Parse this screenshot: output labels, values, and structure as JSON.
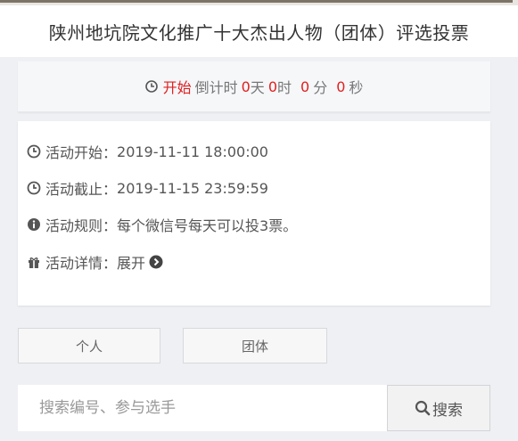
{
  "header": {
    "title": "陕州地坑院文化推广十大杰出人物（团体）评选投票"
  },
  "countdown": {
    "status": "开始",
    "prefix": "倒计时",
    "days": "0",
    "days_unit": "天",
    "hours": "0",
    "hours_unit": "时",
    "minutes": "0",
    "minutes_unit": "分",
    "seconds": "0",
    "seconds_unit": "秒",
    "icon": "clock-icon",
    "accent_color": "#e02020"
  },
  "info": {
    "start_label": "活动开始：",
    "start_value": "2019-11-11 18:00:00",
    "end_label": "活动截止：",
    "end_value": "2019-11-15 23:59:59",
    "rules_label": "活动规则：",
    "rules_value": "每个微信号每天可以投3票。",
    "details_label": "活动详情：",
    "details_link": "展开"
  },
  "tabs": [
    {
      "label": "个人"
    },
    {
      "label": "团体"
    }
  ],
  "search": {
    "placeholder": "搜索编号、参与选手",
    "value": "",
    "button_label": "搜索"
  }
}
